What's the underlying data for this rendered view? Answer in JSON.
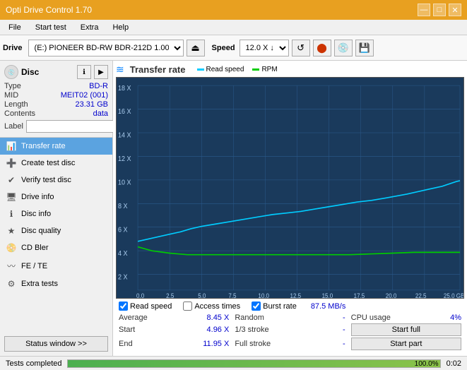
{
  "titlebar": {
    "title": "Opti Drive Control 1.70",
    "minimize": "—",
    "maximize": "□",
    "close": "✕"
  },
  "menubar": {
    "items": [
      "File",
      "Start test",
      "Extra",
      "Help"
    ]
  },
  "toolbar": {
    "drive_label": "Drive",
    "drive_value": "(E:) PIONEER BD-RW   BDR-212D 1.00",
    "speed_label": "Speed",
    "speed_value": "12.0 X ↓"
  },
  "disc": {
    "title": "Disc",
    "type_label": "Type",
    "type_value": "BD-R",
    "mid_label": "MID",
    "mid_value": "MEIT02 (001)",
    "length_label": "Length",
    "length_value": "23.31 GB",
    "contents_label": "Contents",
    "contents_value": "data",
    "label_label": "Label",
    "label_value": ""
  },
  "nav": {
    "items": [
      {
        "id": "transfer-rate",
        "label": "Transfer rate",
        "active": true
      },
      {
        "id": "create-test-disc",
        "label": "Create test disc",
        "active": false
      },
      {
        "id": "verify-test-disc",
        "label": "Verify test disc",
        "active": false
      },
      {
        "id": "drive-info",
        "label": "Drive info",
        "active": false
      },
      {
        "id": "disc-info",
        "label": "Disc info",
        "active": false
      },
      {
        "id": "disc-quality",
        "label": "Disc quality",
        "active": false
      },
      {
        "id": "cd-bler",
        "label": "CD Bler",
        "active": false
      },
      {
        "id": "fe-te",
        "label": "FE / TE",
        "active": false
      },
      {
        "id": "extra-tests",
        "label": "Extra tests",
        "active": false
      }
    ],
    "status_btn": "Status window >>"
  },
  "chart": {
    "title": "Transfer rate",
    "icon": "≋",
    "legend": [
      {
        "label": "Read speed",
        "color": "#00ccff"
      },
      {
        "label": "RPM",
        "color": "#00cc00"
      }
    ],
    "y_axis": [
      "18 X",
      "16 X",
      "14 X",
      "12 X",
      "10 X",
      "8 X",
      "6 X",
      "4 X",
      "2 X"
    ],
    "x_axis": [
      "0.0",
      "2.5",
      "5.0",
      "7.5",
      "10.0",
      "12.5",
      "15.0",
      "17.5",
      "20.0",
      "22.5",
      "25.0 GB"
    ]
  },
  "checkboxes": {
    "read_speed": {
      "label": "Read speed",
      "checked": true
    },
    "access_times": {
      "label": "Access times",
      "checked": false
    },
    "burst_rate": {
      "label": "Burst rate",
      "checked": true
    },
    "burst_val": "87.5 MB/s"
  },
  "stats": {
    "average_label": "Average",
    "average_val": "8.45 X",
    "random_label": "Random",
    "random_val": "-",
    "cpu_label": "CPU usage",
    "cpu_val": "4%",
    "start_label": "Start",
    "start_val": "4.96 X",
    "stroke1_label": "1/3 stroke",
    "stroke1_val": "-",
    "start_full_btn": "Start full",
    "end_label": "End",
    "end_val": "11.95 X",
    "stroke2_label": "Full stroke",
    "stroke2_val": "-",
    "start_part_btn": "Start part"
  },
  "statusbar": {
    "text": "Tests completed",
    "progress": 100,
    "progress_label": "100.0%",
    "time": "0:02"
  }
}
